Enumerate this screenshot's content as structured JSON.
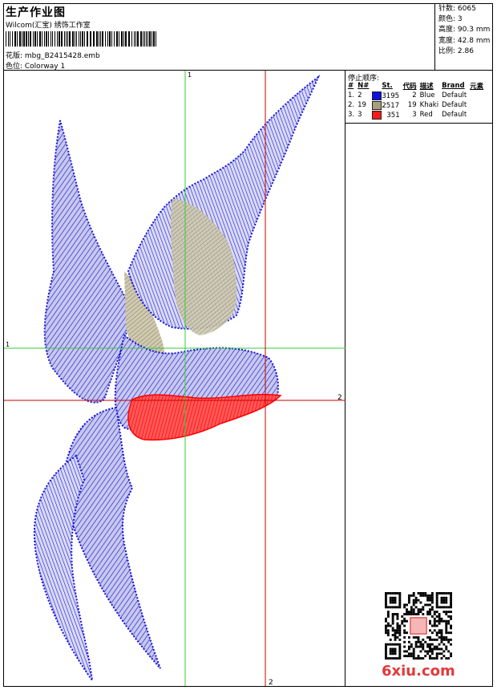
{
  "header": {
    "title": "生产作业图",
    "company": "Wilcom(汇宝) 绣饰工作室",
    "design_line": "花版:  mbg_B2415428.emb",
    "colorway_line": "色位:  Colorway 1"
  },
  "stats": [
    {
      "label": "针数:",
      "value": "6065"
    },
    {
      "label": "颜色:",
      "value": "3"
    },
    {
      "label": "高度:",
      "value": "90.3 mm"
    },
    {
      "label": "宽度:",
      "value": "42.8 mm"
    },
    {
      "label": "比例:",
      "value": "2.86"
    }
  ],
  "stop_sequence": {
    "title": "停止顺序:",
    "headers": [
      "#",
      "N#",
      "St.",
      "代码",
      "描述",
      "Brand",
      "元素"
    ],
    "rows": [
      {
        "idx": "1.",
        "n": "2",
        "color": "#1010e0",
        "stitches": "3195",
        "code": "2",
        "desc": "Blue",
        "brand": "Default"
      },
      {
        "idx": "2.",
        "n": "19",
        "color": "#a8a07a",
        "stitches": "2517",
        "code": "19",
        "desc": "Khaki",
        "brand": "Default"
      },
      {
        "idx": "3.",
        "n": "3",
        "color": "#ff1a1a",
        "stitches": "351",
        "code": "3",
        "desc": "Red",
        "brand": "Default"
      }
    ]
  },
  "guides": {
    "green_v_label": "1",
    "green_h_label": "1",
    "red_h_label": "2",
    "red_v_label": "2"
  },
  "watermark": "6xiu.com",
  "colors": {
    "blue": "#1010e0",
    "khaki": "#a8a07a",
    "red": "#ff1a1a",
    "green": "#33cc33",
    "guide_red": "#cc0000"
  }
}
